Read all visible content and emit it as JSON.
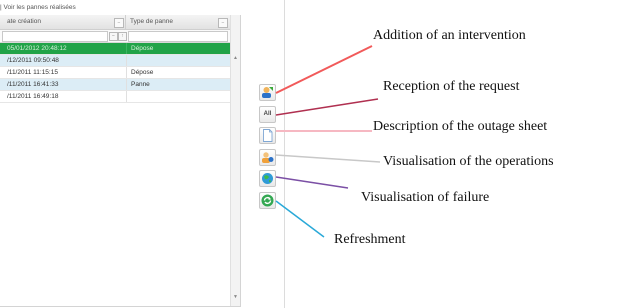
{
  "panel": {
    "checkbox_label": "| Voir les pannes réalisées",
    "columns": [
      "ate création",
      "Type de panne"
    ],
    "header_button_glyph": "−",
    "filter_glyphs": [
      "−",
      "↑"
    ],
    "rows": [
      {
        "date": "05/01/2012 20:48:12",
        "type": "Dépose",
        "state": "selected"
      },
      {
        "date": "/12/2011 09:50:48",
        "type": "",
        "state": "alt"
      },
      {
        "date": "/11/2011 11:15:15",
        "type": "Dépose",
        "state": "normal"
      },
      {
        "date": "/11/2011 16:41:33",
        "type": "Panne",
        "state": "alt"
      },
      {
        "date": "/11/2011 16:49:18",
        "type": "",
        "state": "normal"
      }
    ],
    "scroll_up_glyph": "▲",
    "scroll_down_glyph": "▼"
  },
  "toolbar": {
    "buttons": [
      {
        "id": "add-intervention",
        "icon": "add-user-icon"
      },
      {
        "id": "reception-request",
        "icon": "all-text-icon",
        "text": "All"
      },
      {
        "id": "outage-sheet",
        "icon": "document-icon"
      },
      {
        "id": "operations",
        "icon": "user-gear-icon"
      },
      {
        "id": "failure",
        "icon": "globe-icon"
      },
      {
        "id": "refresh",
        "icon": "refresh-icon"
      }
    ]
  },
  "callouts": {
    "addition": "Addition of an intervention",
    "reception": "Reception of the request",
    "description": "Description of the outage sheet",
    "operations": "Visualisation of the operations",
    "failure": "Visualisation of  failure",
    "refresh": "Refreshment"
  },
  "colors": {
    "addition": "#f15a5a",
    "reception": "#b03050",
    "description": "#f6b8c2",
    "operations": "#c8c8c8",
    "failure": "#7b4fa5",
    "refresh": "#2aa9d8",
    "selected_row": "#21a348",
    "alt_row": "#dcedf6"
  }
}
